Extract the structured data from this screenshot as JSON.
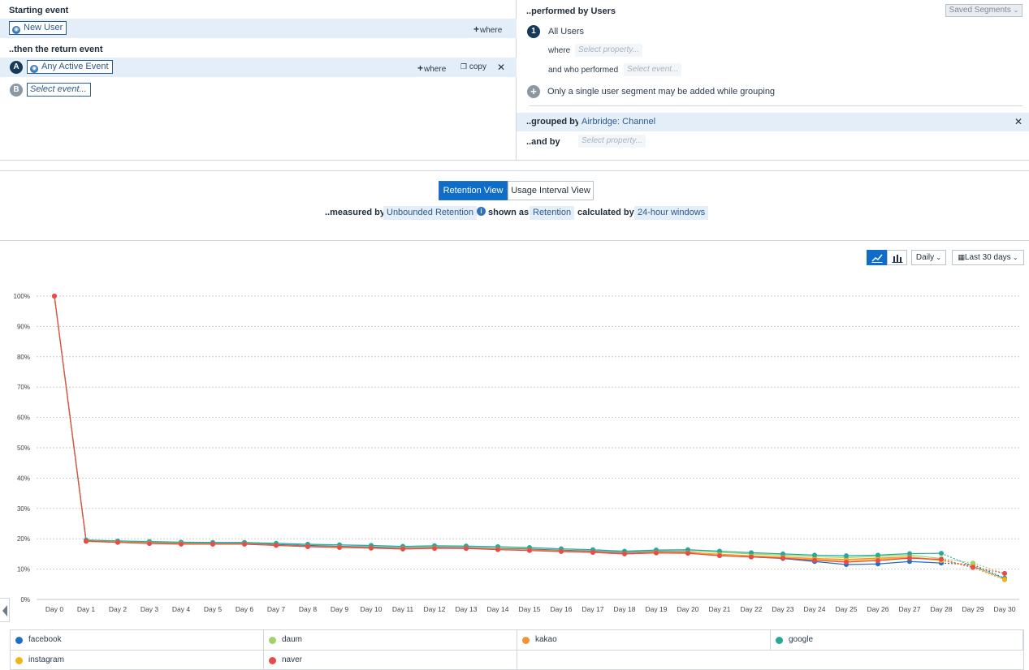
{
  "query": {
    "starting_event_label": "Starting event",
    "starting_event": "New User",
    "starting_where": "where",
    "return_event_label": "..then the return event",
    "event_a_badge": "A",
    "event_a": "Any Active Event",
    "event_a_where": "where",
    "event_a_copy": "copy",
    "event_b_badge": "B",
    "event_b_placeholder": "Select event...",
    "performed_by_label": "..performed by Users",
    "saved_segments": "Saved Segments",
    "segment_badge": "1",
    "segment_name": "All Users",
    "where_label": "where",
    "where_placeholder": "Select property...",
    "who_performed_label": "and who performed",
    "who_performed_placeholder": "Select event...",
    "single_segment_note": "Only a single user segment may be added while grouping",
    "grouped_by_label": "..grouped by",
    "grouped_by_value": "Airbridge: Channel",
    "and_by_label": "..and by",
    "and_by_placeholder": "Select property..."
  },
  "view": {
    "retention_view": "Retention View",
    "usage_interval_view": "Usage Interval View",
    "measured_by_label": "..measured by",
    "measured_by_value": "Unbounded Retention",
    "shown_as_label": "shown as",
    "shown_as_value": "Retention",
    "calculated_by_label": "calculated by",
    "calculated_by_value": "24-hour windows"
  },
  "controls": {
    "interval": "Daily",
    "date_range": "Last 30 days",
    "line_icon": "line-chart-icon",
    "bar_icon": "bar-chart-icon"
  },
  "chart_data": {
    "type": "line",
    "categories": [
      "Day 0",
      "Day 1",
      "Day 2",
      "Day 3",
      "Day 4",
      "Day 5",
      "Day 6",
      "Day 7",
      "Day 8",
      "Day 9",
      "Day 10",
      "Day 11",
      "Day 12",
      "Day 13",
      "Day 14",
      "Day 15",
      "Day 16",
      "Day 17",
      "Day 18",
      "Day 19",
      "Day 20",
      "Day 21",
      "Day 22",
      "Day 23",
      "Day 24",
      "Day 25",
      "Day 26",
      "Day 27",
      "Day 28",
      "Day 29",
      "Day 30"
    ],
    "y_ticks": [
      "0%",
      "10%",
      "20%",
      "30%",
      "40%",
      "50%",
      "60%",
      "70%",
      "80%",
      "90%",
      "100%"
    ],
    "ylim": [
      0,
      100
    ],
    "grid": true,
    "legend_position": "bottom",
    "series": [
      {
        "name": "facebook",
        "color": "#1f6fc5",
        "values": [
          100,
          19.3,
          19.0,
          18.8,
          18.6,
          18.5,
          18.5,
          18.1,
          17.8,
          17.5,
          17.3,
          17.0,
          17.2,
          17.1,
          16.8,
          16.6,
          16.2,
          15.9,
          15.4,
          15.8,
          15.7,
          14.5,
          14.0,
          13.5,
          12.5,
          11.5,
          11.7,
          12.5,
          12.0,
          11.5,
          7.0
        ]
      },
      {
        "name": "daum",
        "color": "#9fd36a",
        "values": [
          100,
          19.5,
          19.2,
          19.0,
          18.8,
          18.7,
          18.7,
          18.4,
          18.1,
          17.9,
          17.7,
          17.4,
          17.6,
          17.5,
          17.3,
          17.0,
          16.6,
          16.3,
          15.8,
          16.2,
          16.2,
          15.5,
          15.0,
          14.6,
          14.1,
          13.8,
          14.2,
          14.6,
          13.5,
          12.0,
          8.5
        ]
      },
      {
        "name": "kakao",
        "color": "#f39237",
        "values": [
          100,
          19.2,
          18.9,
          18.6,
          18.4,
          18.3,
          18.3,
          17.9,
          17.5,
          17.3,
          17.0,
          16.8,
          17.0,
          16.9,
          16.6,
          16.4,
          16.0,
          15.7,
          15.2,
          15.6,
          15.5,
          14.9,
          14.4,
          14.0,
          13.5,
          13.2,
          13.6,
          14.0,
          13.0,
          10.5,
          6.5
        ]
      },
      {
        "name": "google",
        "color": "#27a899",
        "values": [
          100,
          19.6,
          19.3,
          19.1,
          18.9,
          18.8,
          18.8,
          18.5,
          18.2,
          18.0,
          17.8,
          17.5,
          17.7,
          17.6,
          17.4,
          17.1,
          16.7,
          16.4,
          15.9,
          16.3,
          16.4,
          15.9,
          15.4,
          15.0,
          14.6,
          14.4,
          14.6,
          15.1,
          15.2,
          10.9,
          6.8
        ]
      },
      {
        "name": "instagram",
        "color": "#f4b417",
        "values": [
          100,
          19.1,
          18.8,
          18.5,
          18.3,
          18.2,
          18.2,
          17.8,
          17.4,
          17.2,
          16.9,
          16.7,
          16.9,
          16.8,
          16.5,
          16.2,
          15.8,
          15.5,
          15.0,
          15.4,
          15.3,
          14.7,
          14.2,
          13.8,
          13.2,
          12.8,
          13.2,
          13.8,
          12.8,
          11.0,
          6.6
        ]
      },
      {
        "name": "naver",
        "color": "#e94a4a",
        "values": [
          100,
          19.2,
          18.8,
          18.4,
          18.2,
          18.2,
          18.2,
          17.8,
          17.4,
          17.1,
          16.9,
          16.6,
          16.8,
          16.8,
          16.4,
          16.1,
          15.8,
          15.5,
          15.0,
          15.3,
          15.2,
          14.4,
          14.0,
          13.6,
          12.9,
          12.3,
          12.8,
          13.6,
          13.2,
          10.6,
          8.6
        ]
      }
    ]
  }
}
